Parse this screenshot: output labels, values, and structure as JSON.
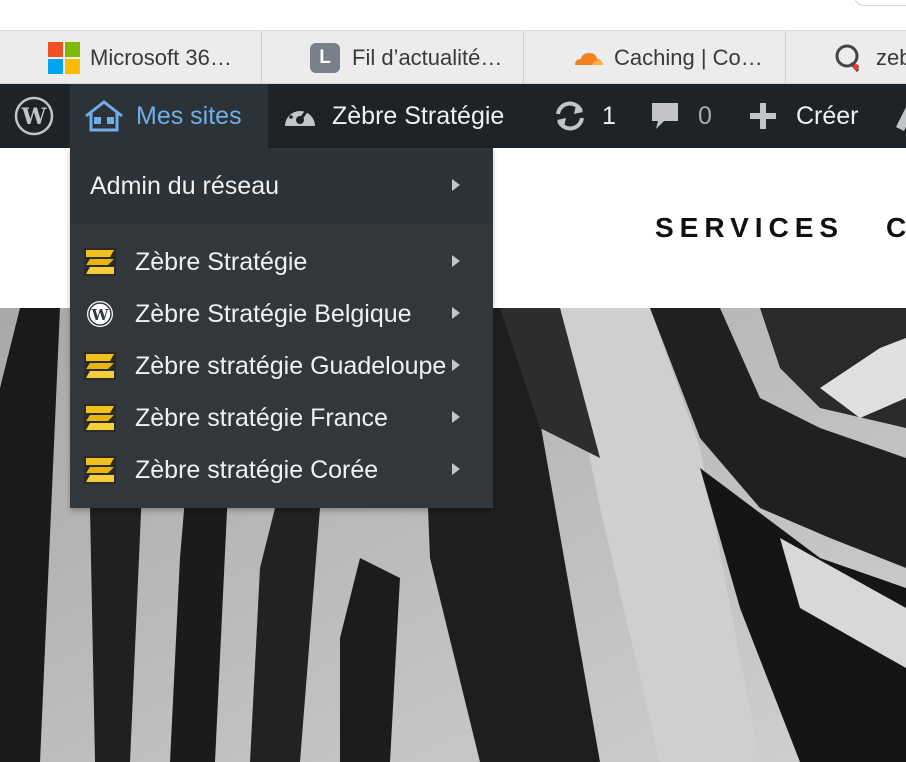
{
  "bookmarks": [
    {
      "label": "Microsoft 36…",
      "icon": "microsoft-logo-icon"
    },
    {
      "label": "Fil d’actualité…",
      "icon": "l-letter-icon",
      "icon_letter": "L"
    },
    {
      "label": "Caching | Co…",
      "icon": "cloudflare-icon"
    },
    {
      "label": "zeb",
      "icon": "q-logo-icon"
    }
  ],
  "adminbar": {
    "my_sites": "Mes sites",
    "site_name": "Zèbre Stratégie",
    "updates_count": "1",
    "comments_count": "0",
    "new_label": "Créer"
  },
  "dropdown": {
    "network_admin": "Admin du réseau",
    "sites": [
      {
        "label": "Zèbre Stratégie",
        "icon": "zebre-logo-icon"
      },
      {
        "label": "Zèbre Stratégie Belgique",
        "icon": "wordpress-icon"
      },
      {
        "label": "Zèbre stratégie Guadeloupe",
        "icon": "zebre-logo-icon"
      },
      {
        "label": "Zèbre stratégie France",
        "icon": "zebre-logo-icon"
      },
      {
        "label": "Zèbre stratégie Corée",
        "icon": "zebre-logo-icon"
      }
    ]
  },
  "site_nav": {
    "services": "SERVICES",
    "partial_item": "C"
  },
  "colors": {
    "adminbar_bg": "#1d2327",
    "dropdown_bg": "#32373c",
    "highlight_blue": "#72aee6",
    "logo_gold": "#f2c21a"
  }
}
